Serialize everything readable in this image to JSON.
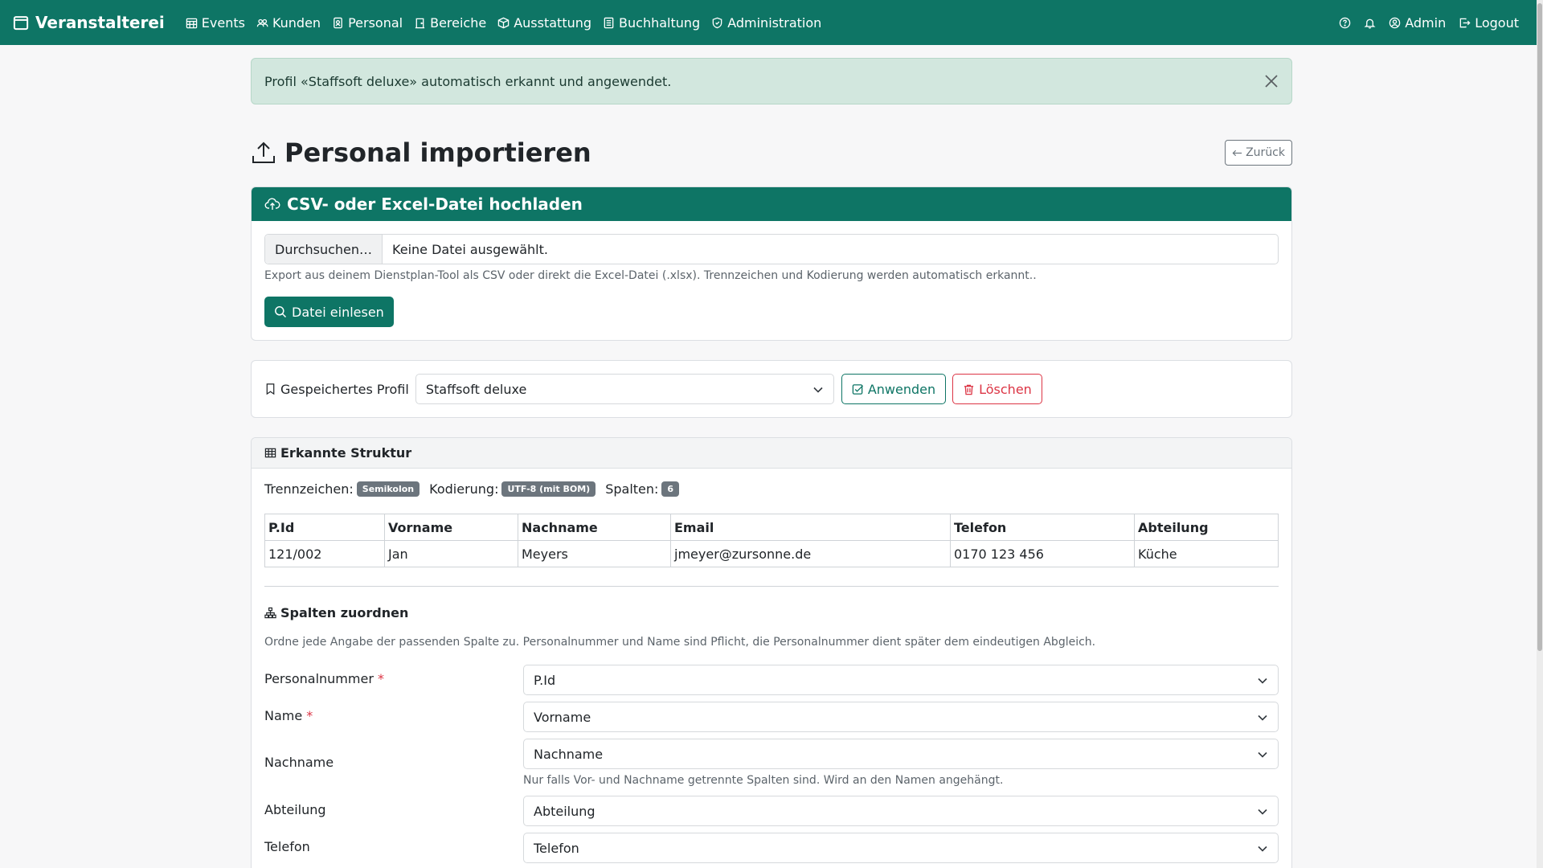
{
  "navbar": {
    "brand": "Veranstalterei",
    "items": [
      {
        "label": "Events",
        "icon": "calendar-grid-icon"
      },
      {
        "label": "Kunden",
        "icon": "people-icon"
      },
      {
        "label": "Personal",
        "icon": "badge-icon"
      },
      {
        "label": "Bereiche",
        "icon": "door-icon"
      },
      {
        "label": "Ausstattung",
        "icon": "box-icon"
      },
      {
        "label": "Buchhaltung",
        "icon": "ledger-icon"
      },
      {
        "label": "Administration",
        "icon": "shield-icon"
      }
    ],
    "user": "Admin",
    "logout": "Logout"
  },
  "alert": {
    "text": "Profil «Staffsoft deluxe» automatisch erkannt und angewendet."
  },
  "page": {
    "title": "Personal importieren",
    "back": "Zurück"
  },
  "upload": {
    "title": "CSV- oder Excel-Datei hochladen",
    "browse": "Durchsuchen…",
    "no_file": "Keine Datei ausgewählt.",
    "help": "Export aus deinem Dienstplan-Tool als CSV oder direkt die Excel-Datei (.xlsx). Trennzeichen und Kodierung werden automatisch erkannt..",
    "button": "Datei einlesen"
  },
  "profile": {
    "label": "Gespeichertes Profil",
    "selected": "Staffsoft deluxe",
    "apply": "Anwenden",
    "delete": "Löschen"
  },
  "structure": {
    "title": "Erkannte Struktur",
    "separator_label": "Trennzeichen:",
    "separator": "Semikolon",
    "encoding_label": "Kodierung:",
    "encoding": "UTF-8 (mit BOM)",
    "columns_label": "Spalten:",
    "columns": "6",
    "table": {
      "headers": [
        "P.Id",
        "Vorname",
        "Nachname",
        "Email",
        "Telefon",
        "Abteilung"
      ],
      "rows": [
        [
          "121/002",
          "Jan",
          "Meyers",
          "jmeyer@zursonne.de",
          "0170 123 456",
          "Küche"
        ]
      ]
    }
  },
  "mapping": {
    "title": "Spalten zuordnen",
    "help": "Ordne jede Angabe der passenden Spalte zu. Personalnummer und Name sind Pflicht, die Personalnummer dient später dem eindeutigen Abgleich.",
    "required_mark": "*",
    "fields": [
      {
        "label": "Personalnummer",
        "value": "P.Id",
        "required": true
      },
      {
        "label": "Name",
        "value": "Vorname",
        "required": true
      },
      {
        "label": "Nachname",
        "value": "Nachname",
        "required": false,
        "help": "Nur falls Vor- und Nachname getrennte Spalten sind. Wird an den Namen angehängt."
      },
      {
        "label": "Abteilung",
        "value": "Abteilung",
        "required": false
      },
      {
        "label": "Telefon",
        "value": "Telefon",
        "required": false
      }
    ]
  },
  "colors": {
    "primary": "#0e7565",
    "alert_bg": "#d2e7de",
    "danger": "#dc3545",
    "badge": "#6c757d"
  }
}
